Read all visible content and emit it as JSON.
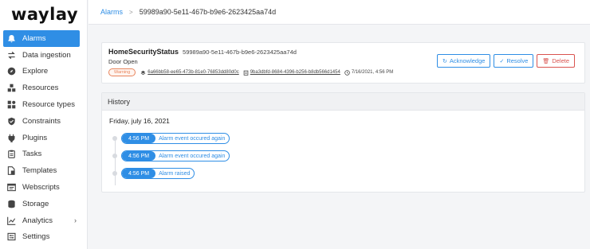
{
  "app": {
    "logo": "waylay"
  },
  "sidebar": {
    "items": [
      {
        "label": "Alarms",
        "icon": "bell-icon",
        "active": true
      },
      {
        "label": "Data ingestion",
        "icon": "arrows-icon"
      },
      {
        "label": "Explore",
        "icon": "compass-icon"
      },
      {
        "label": "Resources",
        "icon": "cubes-icon"
      },
      {
        "label": "Resource types",
        "icon": "shapes-icon"
      },
      {
        "label": "Constraints",
        "icon": "shield-icon"
      },
      {
        "label": "Plugins",
        "icon": "plug-icon"
      },
      {
        "label": "Tasks",
        "icon": "clipboard-icon"
      },
      {
        "label": "Templates",
        "icon": "template-icon"
      },
      {
        "label": "Webscripts",
        "icon": "code-window-icon"
      },
      {
        "label": "Storage",
        "icon": "database-icon"
      },
      {
        "label": "Analytics",
        "icon": "chart-icon",
        "has_submenu": true
      },
      {
        "label": "Settings",
        "icon": "gear-icon"
      }
    ]
  },
  "breadcrumb": {
    "parent": "Alarms",
    "separator": ">",
    "current": "59989a90-5e11-467b-b9e6-2623425aa74d"
  },
  "alarm": {
    "type": "HomeSecurityStatus",
    "id": "59989a90-5e11-467b-b9e6-2623425aa74d",
    "message": "Door Open",
    "severity": "Warning",
    "resource": "6a66bb58-ee65-473b-81e0-76853dd80d0c",
    "task": "9ba3dbfd-8684-4396-b256-b8db566d1454",
    "timestamp": "7/16/2021, 4:56 PM"
  },
  "actions": {
    "acknowledge": "Acknowledge",
    "resolve": "Resolve",
    "delete": "Delete"
  },
  "history": {
    "title": "History",
    "date": "Friday, july 16, 2021",
    "events": [
      {
        "time": "4:56 PM",
        "text": "Alarm event occured again"
      },
      {
        "time": "4:56 PM",
        "text": "Alarm event occured again"
      },
      {
        "time": "4:56 PM",
        "text": "Alarm raised"
      }
    ]
  },
  "colors": {
    "accent": "#2f8ee5",
    "warning": "#e8845c",
    "danger": "#d9534f"
  }
}
